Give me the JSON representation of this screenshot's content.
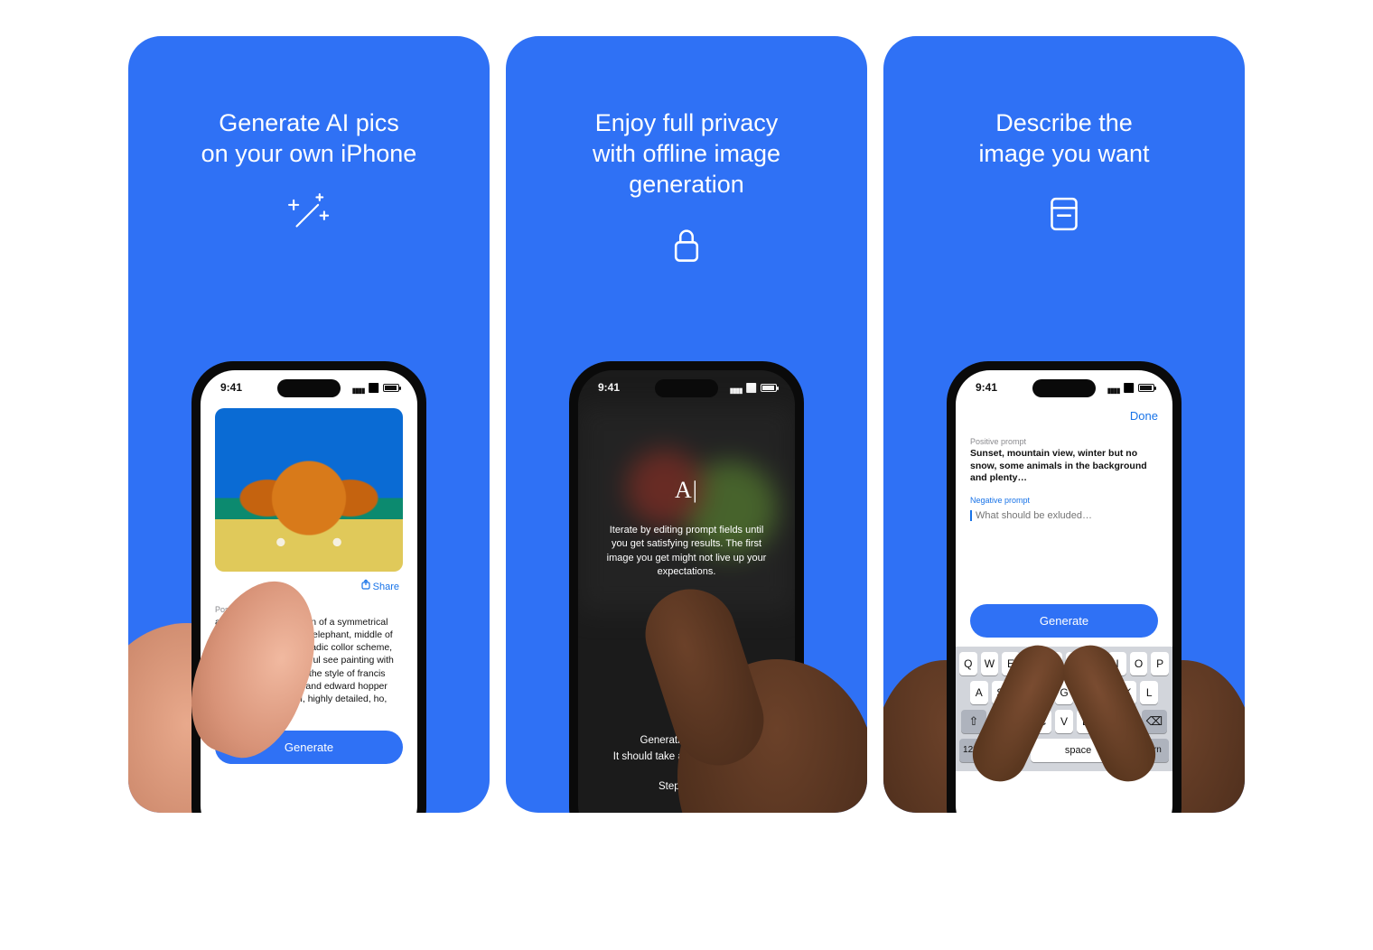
{
  "statusbar": {
    "time": "9:41"
  },
  "cards": [
    {
      "headline": "Generate AI pics\non your own iPhone",
      "icon": "sparkles-wand-icon"
    },
    {
      "headline": "Enjoy full privacy\nwith offline image\ngeneration",
      "icon": "lock-icon"
    },
    {
      "headline": "Describe the\nimage you want",
      "icon": "note-icon"
    }
  ],
  "screen1": {
    "share_label": "Share",
    "positive_prompt_label": "Positive prompt",
    "positive_prompt_value": "a portrait and illustration of a symmetrical face of a photorealistic elephant, middle of the canvas, centred, triadic collor scheme, fuji superia 400, beautiful see painting with highly detailed face in the style of francis bacon and syd mead and edward hopper and norman rockwell, highly detailed, ho, intricate details",
    "generate_label": "Generate"
  },
  "screen2": {
    "cursor_glyph": "A|",
    "tip": "Iterate by editing prompt fields until you get satisfying results. The first image you get might not live up your expectations.",
    "status_line1": "Generating image…",
    "status_line2": "It should take about 30 seconds",
    "step": "Step 6 of 25"
  },
  "screen3": {
    "done_label": "Done",
    "positive_prompt_label": "Positive prompt",
    "positive_prompt_value": "Sunset, mountain view, winter but no snow, some animals in the background and plenty…",
    "negative_prompt_label": "Negative prompt",
    "negative_prompt_placeholder": "What should be exluded…",
    "generate_label": "Generate",
    "keyboard": {
      "row1": [
        "Q",
        "W",
        "E",
        "R",
        "T",
        "Y",
        "U",
        "I",
        "O",
        "P"
      ],
      "row2": [
        "A",
        "S",
        "D",
        "F",
        "G",
        "H",
        "J",
        "K",
        "L"
      ],
      "row3": [
        "Z",
        "X",
        "C",
        "V",
        "B",
        "N",
        "M"
      ],
      "space": "space",
      "return": "return",
      "numbers": "123"
    }
  }
}
